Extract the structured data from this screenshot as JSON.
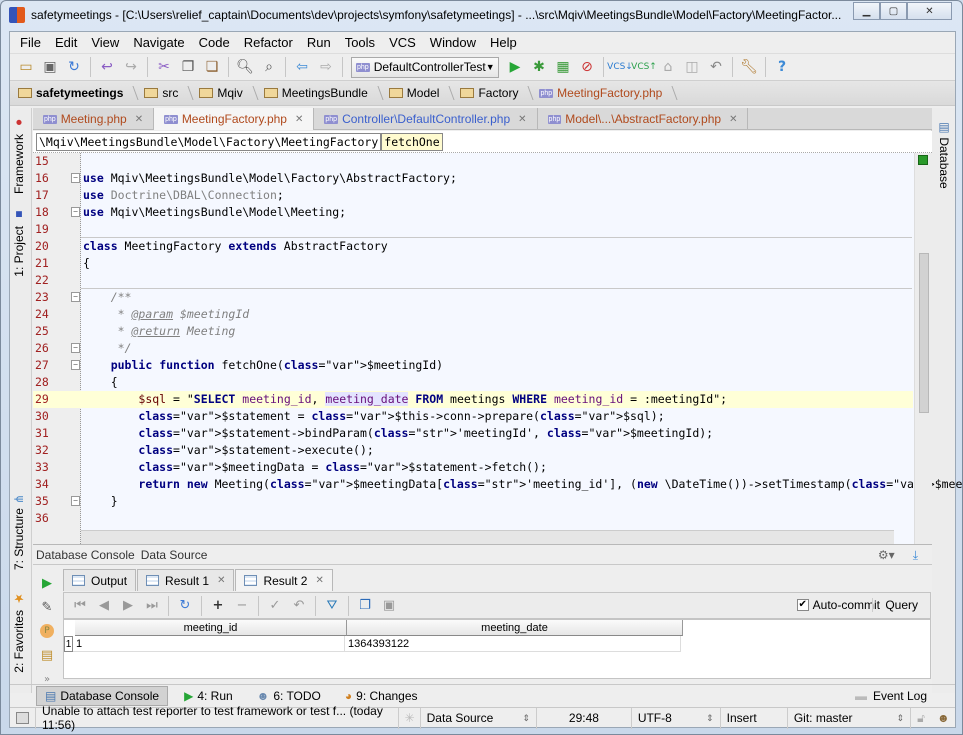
{
  "window": {
    "title": "safetymeetings - [C:\\Users\\relief_captain\\Documents\\dev\\projects\\symfony\\safetymeetings] - ...\\src\\Mqiv\\MeetingsBundle\\Model\\Factory\\MeetingFactor...",
    "controls": {
      "minimize": "▭",
      "maximize": "□",
      "close": "✕"
    }
  },
  "menu": [
    "File",
    "Edit",
    "View",
    "Navigate",
    "Code",
    "Refactor",
    "Run",
    "Tools",
    "VCS",
    "Window",
    "Help"
  ],
  "toolbar": {
    "run_config": "DefaultControllerTest",
    "icons": [
      "open-icon",
      "save-icon",
      "sync-icon",
      "undo-icon",
      "redo-icon",
      "cut-icon",
      "copy-icon",
      "paste-icon",
      "find-icon",
      "replace-icon",
      "back-icon",
      "forward-icon",
      "run-icon",
      "debug-icon",
      "coverage-icon",
      "stop-icon",
      "vcs-update-icon",
      "vcs-commit-icon",
      "vcs-compare-icon",
      "vcs-history-icon",
      "vcs-revert-icon",
      "settings-icon",
      "help-icon"
    ]
  },
  "breadcrumbs": [
    "safetymeetings",
    "src",
    "Mqiv",
    "MeetingsBundle",
    "Model",
    "Factory",
    "MeetingFactory.php"
  ],
  "left_tool_windows": [
    "Framework",
    "1: Project",
    "7: Structure",
    "2: Favorites"
  ],
  "right_tool_windows": [
    "Database"
  ],
  "editor_tabs": [
    {
      "label": "Meeting.php",
      "active": false
    },
    {
      "label": "MeetingFactory.php",
      "active": true
    },
    {
      "label": "Controller\\DefaultController.php",
      "active": false
    },
    {
      "label": "Model\\...\\AbstractFactory.php",
      "active": false
    }
  ],
  "editor": {
    "crumb_class": "\\Mqiv\\MeetingsBundle\\Model\\Factory\\MeetingFactory",
    "crumb_method": "fetchOne",
    "current_line": 29,
    "lines": [
      {
        "n": "15",
        "t": ""
      },
      {
        "n": "16",
        "t": "use Mqiv\\MeetingsBundle\\Model\\Factory\\AbstractFactory;"
      },
      {
        "n": "17",
        "t": "use Doctrine\\DBAL\\Connection;"
      },
      {
        "n": "18",
        "t": "use Mqiv\\MeetingsBundle\\Model\\Meeting;"
      },
      {
        "n": "19",
        "t": ""
      },
      {
        "n": "20",
        "t": "class MeetingFactory extends AbstractFactory"
      },
      {
        "n": "21",
        "t": "{"
      },
      {
        "n": "22",
        "t": ""
      },
      {
        "n": "23",
        "t": "    /**"
      },
      {
        "n": "24",
        "t": "     * @param $meetingId"
      },
      {
        "n": "25",
        "t": "     * @return Meeting"
      },
      {
        "n": "26",
        "t": "     */"
      },
      {
        "n": "27",
        "t": "    public function fetchOne($meetingId)"
      },
      {
        "n": "28",
        "t": "    {"
      },
      {
        "n": "29",
        "t": "        $sql = \"SELECT meeting_id, meeting_date FROM meetings WHERE meeting_id = :meetingId\";"
      },
      {
        "n": "30",
        "t": "        $statement = $this->conn->prepare($sql);"
      },
      {
        "n": "31",
        "t": "        $statement->bindParam('meetingId', $meetingId);"
      },
      {
        "n": "32",
        "t": "        $statement->execute();"
      },
      {
        "n": "33",
        "t": "        $meetingData = $statement->fetch();"
      },
      {
        "n": "34",
        "t": "        return new Meeting($meetingData['meeting_id'], (new \\DateTime())->setTimestamp($meetingData['meeting_date']));"
      },
      {
        "n": "35",
        "t": "    }"
      },
      {
        "n": "36",
        "t": ""
      }
    ]
  },
  "console": {
    "header": [
      "Database Console",
      "Data Source"
    ],
    "tabs": [
      {
        "label": "Output",
        "closable": false
      },
      {
        "label": "Result 1",
        "closable": true
      },
      {
        "label": "Result 2",
        "closable": true,
        "active": true
      }
    ],
    "auto_commit_label": "Auto-commit",
    "auto_commit_checked": true,
    "query_label": "Query",
    "columns": [
      "meeting_id",
      "meeting_date"
    ],
    "rows": [
      [
        "1",
        "1364393122"
      ]
    ],
    "row_numbers": [
      "1"
    ]
  },
  "bottom_tools": [
    {
      "label": "Database Console",
      "active": true
    },
    {
      "label": "4: Run"
    },
    {
      "label": "6: TODO"
    },
    {
      "label": "9: Changes"
    }
  ],
  "event_log": "Event Log",
  "status": {
    "message": "Unable to attach test reporter to test framework or test f... (today 11:56)",
    "data_source": "Data Source",
    "position": "29:48",
    "encoding": "UTF-8",
    "mode": "Insert",
    "vcs": "Git: master"
  }
}
